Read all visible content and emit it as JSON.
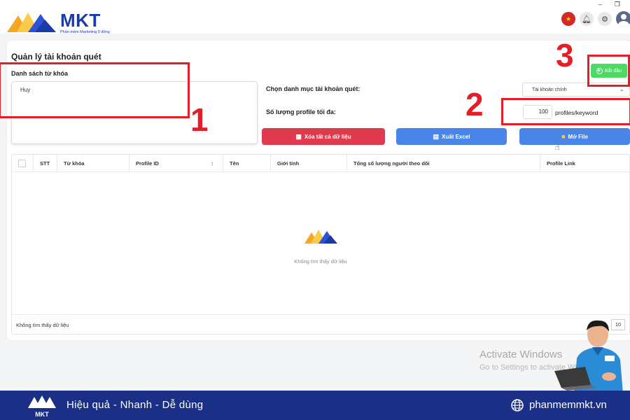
{
  "header": {
    "brand": "MKT",
    "brand_tagline": "Phần mềm Marketing 0 đồng",
    "icons": [
      "vietnam-flag-icon",
      "bell-icon",
      "gear-icon",
      "user-avatar-icon"
    ],
    "window_controls": [
      "–",
      "❐"
    ]
  },
  "page": {
    "title": "Quản lý tài khoản quét"
  },
  "keywords": {
    "label": "Danh sách từ khóa",
    "value": "Huy"
  },
  "settings": {
    "category_label": "Chọn danh mục tài khoản quét:",
    "category_value": "Tài khoản chính",
    "max_label": "Số lượng profile tối đa:",
    "max_value": "100",
    "max_unit": "profiles/keyword"
  },
  "actions": {
    "start": "Bắt đầu",
    "delete_all": "Xóa tất cả dữ liệu",
    "export_excel": "Xuất Excel",
    "open_file": "Mở File"
  },
  "table": {
    "columns": [
      "STT",
      "Từ khóa",
      "Profile ID",
      "Tên",
      "Giới tính",
      "Tổng số lượng người theo dõi",
      "Profile Link"
    ],
    "empty_text": "Không tìm thấy dữ liệu",
    "footer_text": "Không tìm thấy dữ liệu",
    "page_size": "10"
  },
  "annotations": [
    "1",
    "2",
    "3"
  ],
  "watermark": {
    "title": "Activate Windows",
    "subtitle": "Go to Settings to activate Windows."
  },
  "banner": {
    "slogan": "Hiệu quả - Nhanh - Dễ dùng",
    "website": "phanmemmkt.vn",
    "logo_text": "MKT"
  },
  "colors": {
    "brand_blue": "#1b2f86",
    "start_green": "#4cd964",
    "danger_red": "#e03a4e",
    "action_blue": "#4a86e8",
    "annotation_red": "#e41e26"
  }
}
